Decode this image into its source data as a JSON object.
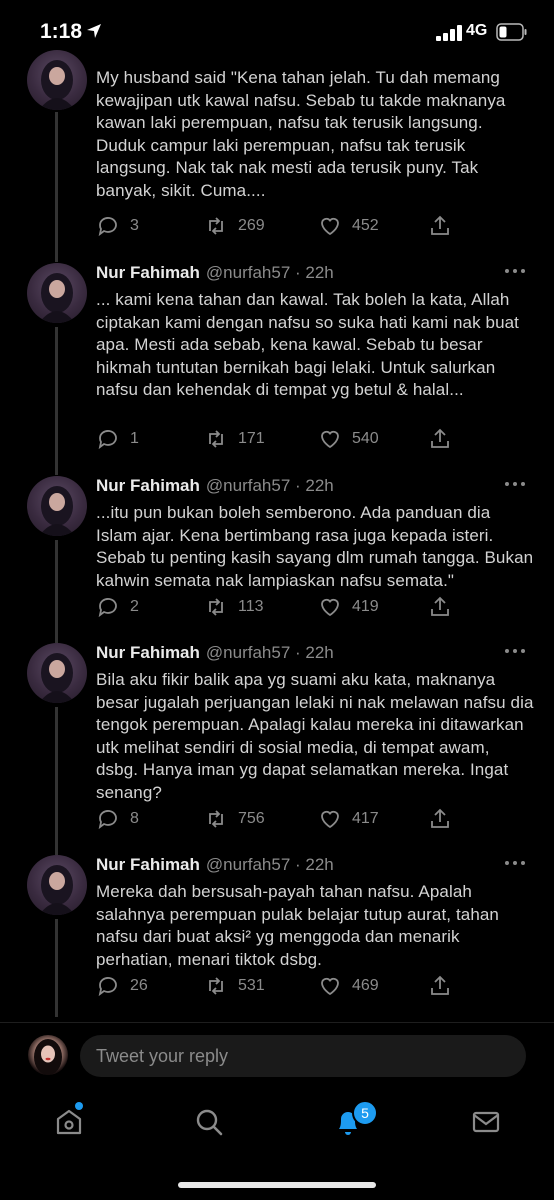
{
  "status_bar": {
    "time": "1:18",
    "network": "4G"
  },
  "tweets": [
    {
      "name": "",
      "handle": "",
      "text": "My husband said \"Kena tahan jelah. Tu dah memang kewajipan utk kawal nafsu. Sebab tu takde maknanya kawan laki perempuan, nafsu tak terusik langsung. Duduk campur laki perempuan, nafsu tak terusik langsung. Nak tak nak mesti ada terusik puny. Tak banyak, sikit. Cuma....",
      "replies": "3",
      "retweets": "269",
      "likes": "452"
    },
    {
      "name": "Nur Fahimah",
      "handle": "@nurfah57 · 22h",
      "text": "... kami kena tahan dan kawal. Tak boleh la kata, Allah ciptakan kami dengan nafsu so suka hati kami nak buat apa. Mesti ada sebab, kena kawal. Sebab tu besar hikmah tuntutan bernikah bagi lelaki. Untuk salurkan nafsu dan kehendak di tempat yg betul & halal...",
      "replies": "1",
      "retweets": "171",
      "likes": "540"
    },
    {
      "name": "Nur Fahimah",
      "handle": "@nurfah57 · 22h",
      "text": "...itu pun bukan boleh semberono. Ada panduan dia Islam ajar. Kena bertimbang rasa juga kepada isteri. Sebab tu penting kasih sayang dlm rumah tangga. Bukan kahwin semata nak lampiaskan nafsu semata.\"",
      "replies": "2",
      "retweets": "113",
      "likes": "419"
    },
    {
      "name": "Nur Fahimah",
      "handle": "@nurfah57 · 22h",
      "text": "Bila aku fikir balik apa yg suami aku kata, maknanya besar jugalah perjuangan lelaki ni nak melawan nafsu dia tengok perempuan. Apalagi kalau mereka ini ditawarkan utk melihat sendiri di sosial media, di tempat awam, dsbg. Hanya iman yg dapat selamatkan mereka. Ingat senang?",
      "replies": "8",
      "retweets": "756",
      "likes": "417"
    },
    {
      "name": "Nur Fahimah",
      "handle": "@nurfah57 · 22h",
      "text": "Mereka dah bersusah-payah tahan nafsu. Apalah salahnya perempuan pulak belajar tutup aurat, tahan nafsu dari buat aksi² yg menggoda dan menarik perhatian, menari tiktok dsbg.",
      "replies": "26",
      "retweets": "531",
      "likes": "469"
    }
  ],
  "reply_bar": {
    "placeholder": "Tweet your reply"
  },
  "tab_bar": {
    "notifications_badge": "5"
  },
  "colors": {
    "background": "#000000",
    "accent": "#1d9bf0",
    "muted": "#8b8b8b"
  }
}
